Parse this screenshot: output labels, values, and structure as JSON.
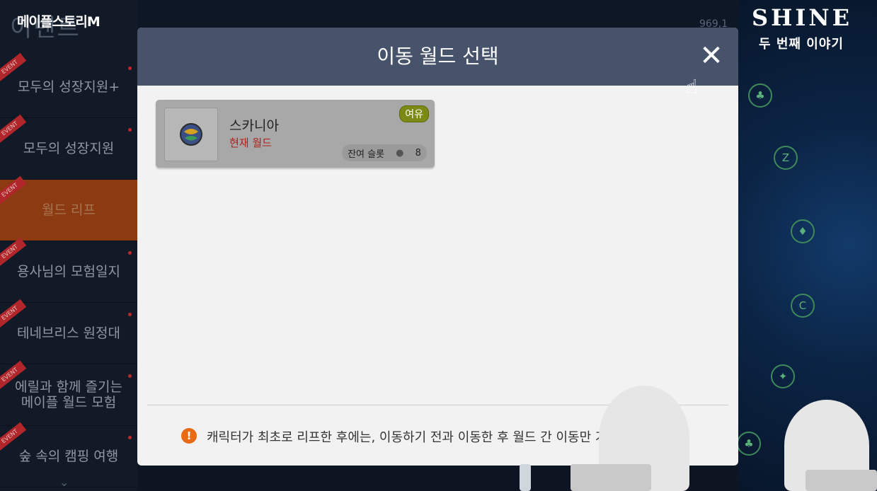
{
  "logo": "메이플스토리M",
  "sidebar": {
    "title": "이벤트",
    "event_tag": "EVENT",
    "items": [
      {
        "label": "모두의 성장지원+"
      },
      {
        "label": "모두의 성장지원"
      },
      {
        "label": "월드 리프"
      },
      {
        "label": "용사님의 모험일지"
      },
      {
        "label": "테네브리스 원정대"
      },
      {
        "label": "에릴과 함께 즐기는\n메이플 월드 모험"
      },
      {
        "label": "숲 속의 캠핑 여행"
      }
    ]
  },
  "overlay": {
    "shine": "SHINE",
    "shine_sub": "두 번째 이야기",
    "currency": "969,1"
  },
  "modal": {
    "title": "이동 월드 선택",
    "close_icon": "close-icon",
    "world": {
      "name": "스카니아",
      "current_label": "현재 월드",
      "status_badge": "여유",
      "slot_label": "잔여 슬롯",
      "slot_count": "8"
    },
    "notice": "캐릭터가 최초로 리프한 후에는, 이동하기 전과 이동한 후 월드 간 이동만 가능합니다."
  },
  "colors": {
    "header": "#46536a",
    "active_item": "#8b3a12",
    "badge": "#7b8a14",
    "current_world": "#b0201e",
    "notice_icon": "#e86a14"
  }
}
